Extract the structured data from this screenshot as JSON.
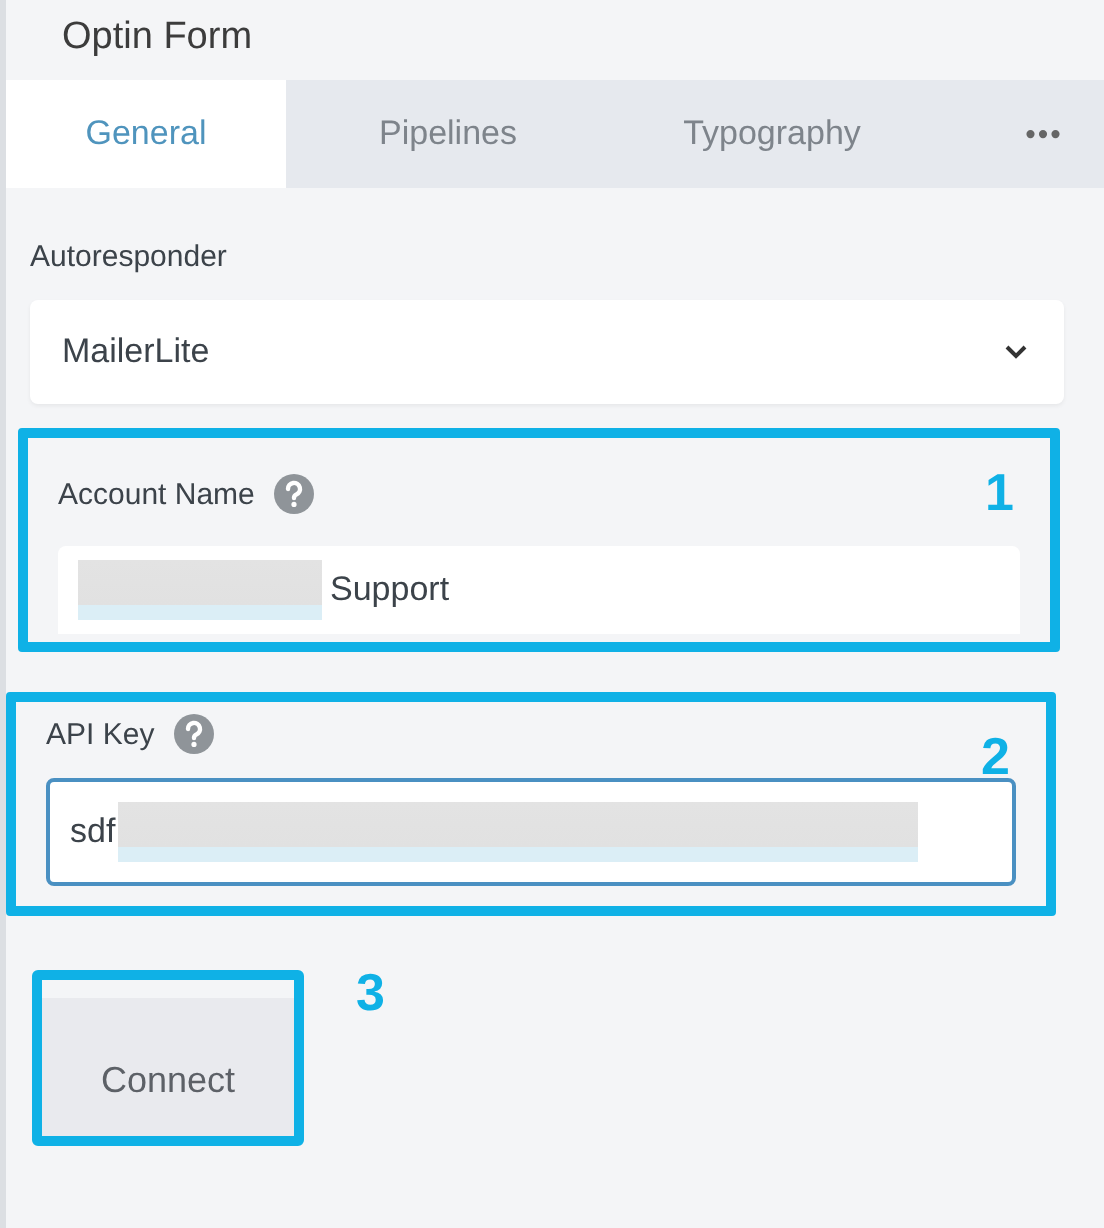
{
  "panel": {
    "title": "Optin Form"
  },
  "tabs": [
    {
      "label": "General",
      "selected": true
    },
    {
      "label": "Pipelines",
      "selected": false
    },
    {
      "label": "Typography",
      "selected": false
    }
  ],
  "more_tabs": "•••",
  "autoresponder": {
    "label": "Autoresponder",
    "value": "MailerLite"
  },
  "fields": [
    {
      "label": "Account Name",
      "help": true,
      "value": "Support",
      "blurred_before": true,
      "blurred_after": false,
      "focused": false,
      "callout": "1"
    },
    {
      "label": "API Key",
      "help": true,
      "value": "sdf",
      "blurred_before": false,
      "blurred_after": true,
      "focused": true,
      "callout": "2"
    }
  ],
  "connect_button": {
    "label": "Connect",
    "callout": "3"
  }
}
